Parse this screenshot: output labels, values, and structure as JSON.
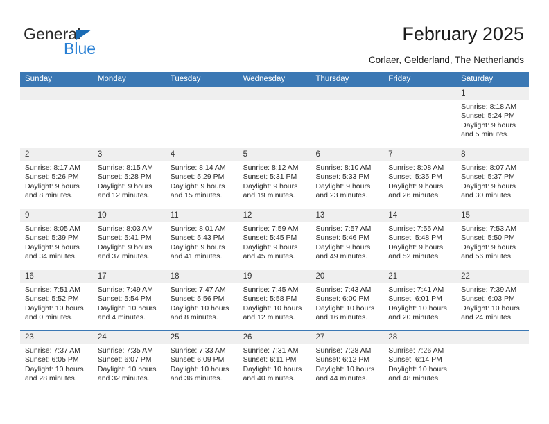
{
  "brand": {
    "name_part1": "General",
    "name_part2": "Blue",
    "triangle_color": "#1b6cb5",
    "blue_color": "#2980d4"
  },
  "header": {
    "title": "February 2025",
    "location": "Corlaer, Gelderland, The Netherlands"
  },
  "theme": {
    "header_blue": "#3b78b4",
    "daynum_band": "#efefef",
    "text": "#2a2a2a"
  },
  "weekdays": [
    "Sunday",
    "Monday",
    "Tuesday",
    "Wednesday",
    "Thursday",
    "Friday",
    "Saturday"
  ],
  "weeks": [
    [
      {
        "day": "",
        "empty": true
      },
      {
        "day": "",
        "empty": true
      },
      {
        "day": "",
        "empty": true
      },
      {
        "day": "",
        "empty": true
      },
      {
        "day": "",
        "empty": true
      },
      {
        "day": "",
        "empty": true
      },
      {
        "day": "1",
        "sunrise": "Sunrise: 8:18 AM",
        "sunset": "Sunset: 5:24 PM",
        "daylight": "Daylight: 9 hours and 5 minutes."
      }
    ],
    [
      {
        "day": "2",
        "sunrise": "Sunrise: 8:17 AM",
        "sunset": "Sunset: 5:26 PM",
        "daylight": "Daylight: 9 hours and 8 minutes."
      },
      {
        "day": "3",
        "sunrise": "Sunrise: 8:15 AM",
        "sunset": "Sunset: 5:28 PM",
        "daylight": "Daylight: 9 hours and 12 minutes."
      },
      {
        "day": "4",
        "sunrise": "Sunrise: 8:14 AM",
        "sunset": "Sunset: 5:29 PM",
        "daylight": "Daylight: 9 hours and 15 minutes."
      },
      {
        "day": "5",
        "sunrise": "Sunrise: 8:12 AM",
        "sunset": "Sunset: 5:31 PM",
        "daylight": "Daylight: 9 hours and 19 minutes."
      },
      {
        "day": "6",
        "sunrise": "Sunrise: 8:10 AM",
        "sunset": "Sunset: 5:33 PM",
        "daylight": "Daylight: 9 hours and 23 minutes."
      },
      {
        "day": "7",
        "sunrise": "Sunrise: 8:08 AM",
        "sunset": "Sunset: 5:35 PM",
        "daylight": "Daylight: 9 hours and 26 minutes."
      },
      {
        "day": "8",
        "sunrise": "Sunrise: 8:07 AM",
        "sunset": "Sunset: 5:37 PM",
        "daylight": "Daylight: 9 hours and 30 minutes."
      }
    ],
    [
      {
        "day": "9",
        "sunrise": "Sunrise: 8:05 AM",
        "sunset": "Sunset: 5:39 PM",
        "daylight": "Daylight: 9 hours and 34 minutes."
      },
      {
        "day": "10",
        "sunrise": "Sunrise: 8:03 AM",
        "sunset": "Sunset: 5:41 PM",
        "daylight": "Daylight: 9 hours and 37 minutes."
      },
      {
        "day": "11",
        "sunrise": "Sunrise: 8:01 AM",
        "sunset": "Sunset: 5:43 PM",
        "daylight": "Daylight: 9 hours and 41 minutes."
      },
      {
        "day": "12",
        "sunrise": "Sunrise: 7:59 AM",
        "sunset": "Sunset: 5:45 PM",
        "daylight": "Daylight: 9 hours and 45 minutes."
      },
      {
        "day": "13",
        "sunrise": "Sunrise: 7:57 AM",
        "sunset": "Sunset: 5:46 PM",
        "daylight": "Daylight: 9 hours and 49 minutes."
      },
      {
        "day": "14",
        "sunrise": "Sunrise: 7:55 AM",
        "sunset": "Sunset: 5:48 PM",
        "daylight": "Daylight: 9 hours and 52 minutes."
      },
      {
        "day": "15",
        "sunrise": "Sunrise: 7:53 AM",
        "sunset": "Sunset: 5:50 PM",
        "daylight": "Daylight: 9 hours and 56 minutes."
      }
    ],
    [
      {
        "day": "16",
        "sunrise": "Sunrise: 7:51 AM",
        "sunset": "Sunset: 5:52 PM",
        "daylight": "Daylight: 10 hours and 0 minutes."
      },
      {
        "day": "17",
        "sunrise": "Sunrise: 7:49 AM",
        "sunset": "Sunset: 5:54 PM",
        "daylight": "Daylight: 10 hours and 4 minutes."
      },
      {
        "day": "18",
        "sunrise": "Sunrise: 7:47 AM",
        "sunset": "Sunset: 5:56 PM",
        "daylight": "Daylight: 10 hours and 8 minutes."
      },
      {
        "day": "19",
        "sunrise": "Sunrise: 7:45 AM",
        "sunset": "Sunset: 5:58 PM",
        "daylight": "Daylight: 10 hours and 12 minutes."
      },
      {
        "day": "20",
        "sunrise": "Sunrise: 7:43 AM",
        "sunset": "Sunset: 6:00 PM",
        "daylight": "Daylight: 10 hours and 16 minutes."
      },
      {
        "day": "21",
        "sunrise": "Sunrise: 7:41 AM",
        "sunset": "Sunset: 6:01 PM",
        "daylight": "Daylight: 10 hours and 20 minutes."
      },
      {
        "day": "22",
        "sunrise": "Sunrise: 7:39 AM",
        "sunset": "Sunset: 6:03 PM",
        "daylight": "Daylight: 10 hours and 24 minutes."
      }
    ],
    [
      {
        "day": "23",
        "sunrise": "Sunrise: 7:37 AM",
        "sunset": "Sunset: 6:05 PM",
        "daylight": "Daylight: 10 hours and 28 minutes."
      },
      {
        "day": "24",
        "sunrise": "Sunrise: 7:35 AM",
        "sunset": "Sunset: 6:07 PM",
        "daylight": "Daylight: 10 hours and 32 minutes."
      },
      {
        "day": "25",
        "sunrise": "Sunrise: 7:33 AM",
        "sunset": "Sunset: 6:09 PM",
        "daylight": "Daylight: 10 hours and 36 minutes."
      },
      {
        "day": "26",
        "sunrise": "Sunrise: 7:31 AM",
        "sunset": "Sunset: 6:11 PM",
        "daylight": "Daylight: 10 hours and 40 minutes."
      },
      {
        "day": "27",
        "sunrise": "Sunrise: 7:28 AM",
        "sunset": "Sunset: 6:12 PM",
        "daylight": "Daylight: 10 hours and 44 minutes."
      },
      {
        "day": "28",
        "sunrise": "Sunrise: 7:26 AM",
        "sunset": "Sunset: 6:14 PM",
        "daylight": "Daylight: 10 hours and 48 minutes."
      },
      {
        "day": "",
        "empty": true
      }
    ]
  ]
}
